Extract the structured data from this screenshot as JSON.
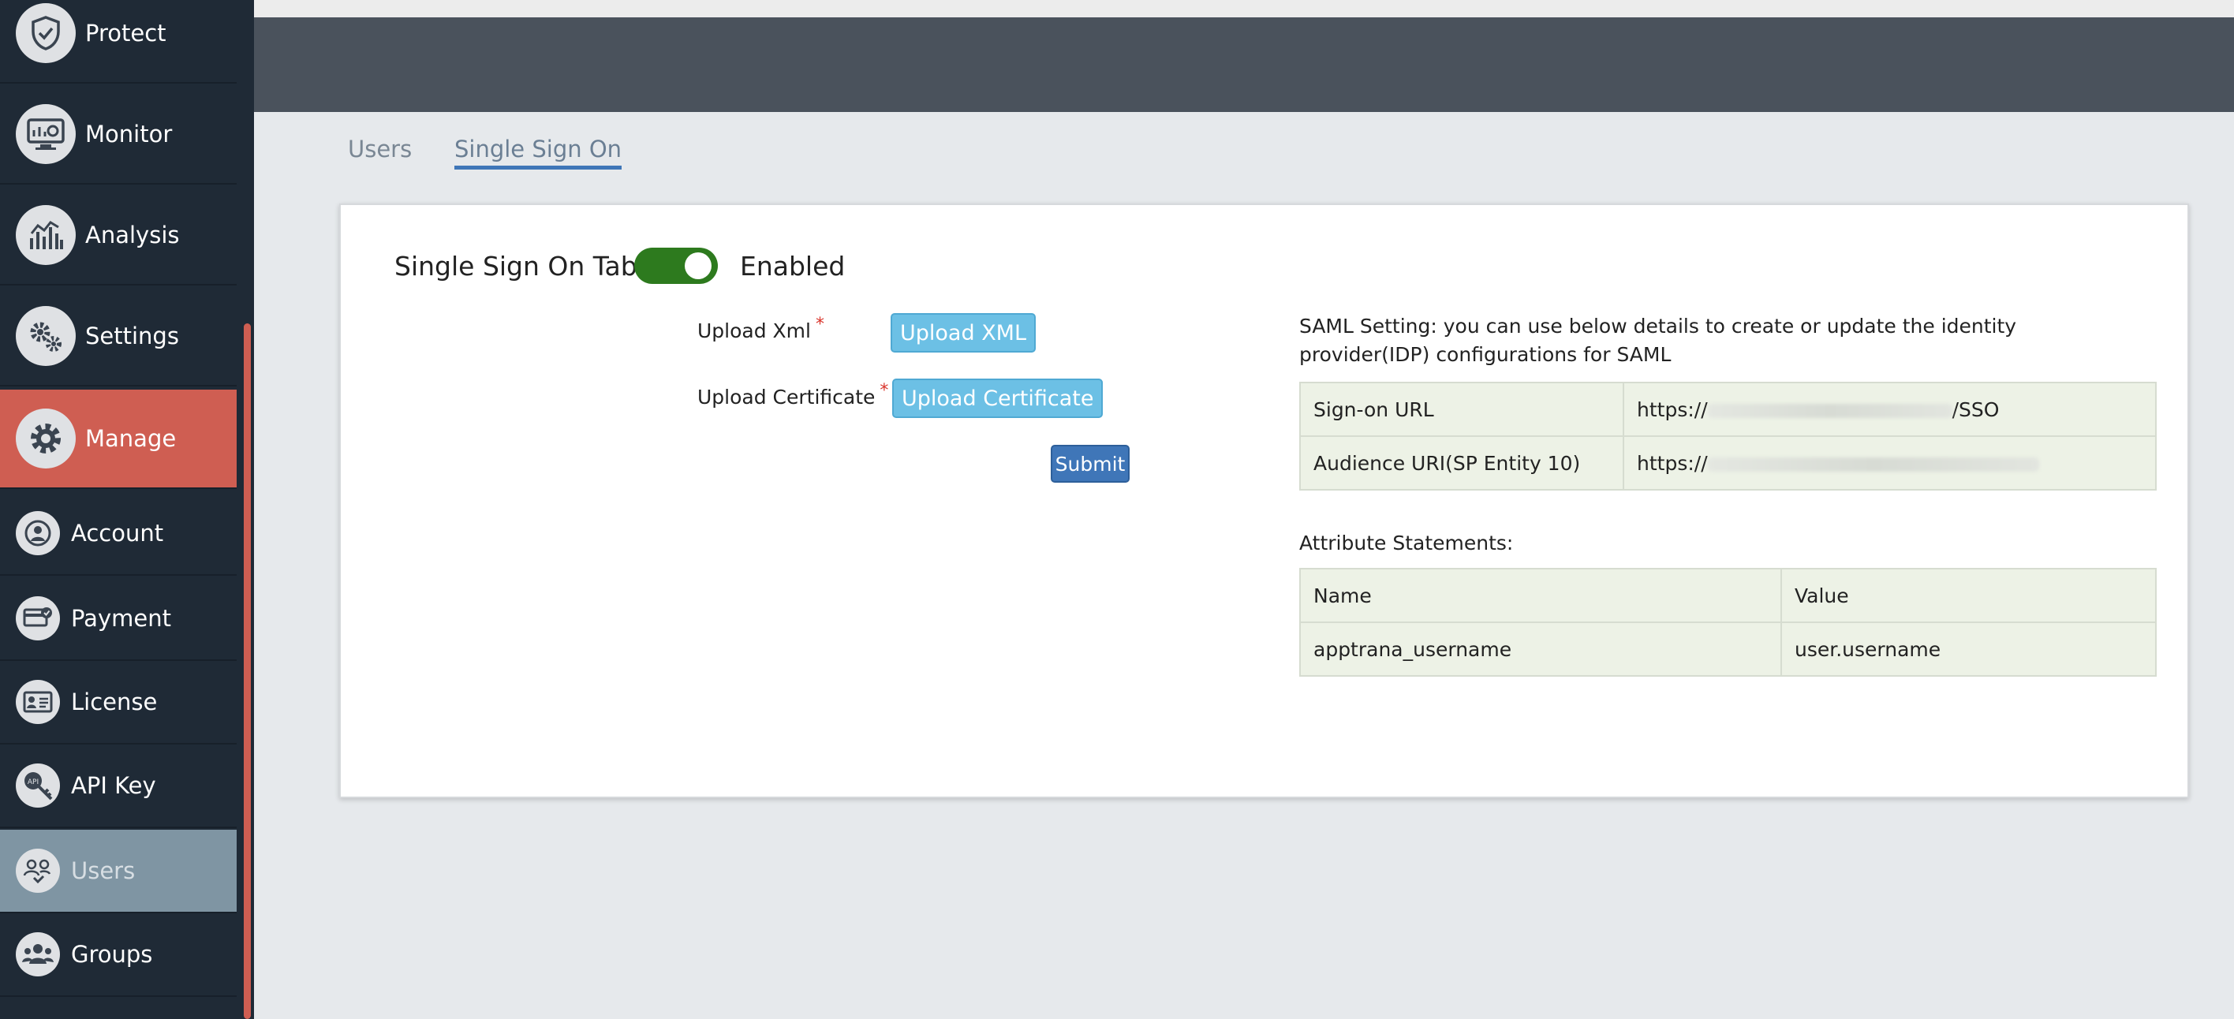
{
  "sidebar": {
    "main_items": [
      {
        "label": "Protect",
        "icon": "shield-icon"
      },
      {
        "label": "Monitor",
        "icon": "monitor-icon"
      },
      {
        "label": "Analysis",
        "icon": "analysis-chart-icon"
      },
      {
        "label": "Settings",
        "icon": "gears-icon"
      },
      {
        "label": "Manage",
        "icon": "gear-icon"
      }
    ],
    "sub_items": [
      {
        "label": "Account",
        "icon": "account-icon"
      },
      {
        "label": "Payment",
        "icon": "payment-card-icon"
      },
      {
        "label": "License",
        "icon": "license-card-icon"
      },
      {
        "label": "API Key",
        "icon": "api-key-icon",
        "icon_text": "API"
      },
      {
        "label": "Users",
        "icon": "users-icon"
      },
      {
        "label": "Groups",
        "icon": "groups-icon"
      }
    ],
    "active_main": "Manage",
    "active_sub": "Users",
    "colors": {
      "background": "#1f2a36",
      "active_main": "#cf5e52",
      "active_sub": "#7f95a3"
    }
  },
  "tabs": [
    {
      "label": "Users",
      "active": false
    },
    {
      "label": "Single Sign On",
      "active": true
    }
  ],
  "sso": {
    "title": "Single Sign On Tab",
    "toggle_state": "Enabled",
    "toggle_color": "#2d7a1e",
    "form": {
      "upload_xml_label": "Upload Xml",
      "upload_xml_button": "Upload XML",
      "upload_cert_label": "Upload Certificate",
      "upload_cert_button": "Upload Certificate",
      "required_mark": "*",
      "submit_button": "Submit"
    },
    "saml_description": "SAML Setting: you can use below details to create or update the identity provider(IDP) configurations for SAML",
    "saml_table": [
      {
        "name": "Sign-on URL",
        "value_prefix": "https://",
        "value_suffix": "/SSO"
      },
      {
        "name": "Audience URI(SP Entity 10)",
        "value_prefix": "https://",
        "value_suffix": ""
      }
    ],
    "attribute_title": "Attribute Statements:",
    "attribute_headers": [
      "Name",
      "Value"
    ],
    "attribute_rows": [
      [
        "apptrana_username",
        "user.username"
      ]
    ]
  }
}
